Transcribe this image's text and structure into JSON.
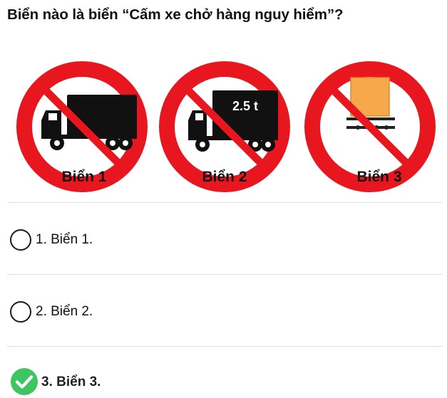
{
  "question": "Biển nào là biển “Cấm xe chở hàng nguy hiểm”?",
  "signs": [
    {
      "label": "Biển 1",
      "icon": "no-truck-sign-icon"
    },
    {
      "label": "Biển 2",
      "icon": "weight-limit-sign-icon",
      "plate_text": "2.5 t"
    },
    {
      "label": "Biển 3",
      "icon": "no-dangerous-goods-sign-icon"
    }
  ],
  "options": [
    {
      "label": "1. Biển 1.",
      "selected": false
    },
    {
      "label": "2. Biển 2.",
      "selected": false
    },
    {
      "label": "3. Biển 3.",
      "selected": true,
      "correct": true
    }
  ],
  "colors": {
    "sign_red": "#e8171f",
    "cargo_orange": "#f7a84a",
    "correct_green": "#3cc562",
    "divider": "#dedede"
  }
}
